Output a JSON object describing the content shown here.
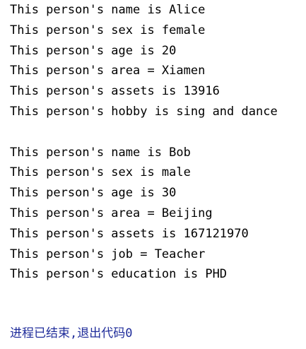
{
  "console": {
    "block1": [
      "This person's name is Alice",
      "This person's sex is female",
      "This person's age is 20",
      "This person's area = Xiamen",
      "This person's assets is 13916",
      "This person's hobby is sing and dance"
    ],
    "block2": [
      "This person's name is Bob",
      "This person's sex is male",
      "This person's age is 30",
      "This person's area = Beijing",
      "This person's assets is 167121970",
      "This person's job = Teacher",
      "This person's education is PHD"
    ],
    "exit_message": "进程已结束,退出代码0"
  },
  "colors": {
    "text": "#000000",
    "exit_text": "#1f2c9a",
    "background": "#ffffff"
  }
}
